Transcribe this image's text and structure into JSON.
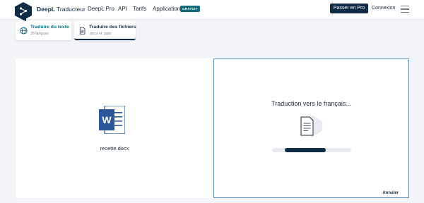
{
  "header": {
    "brand": "DeepL",
    "brand_sub": "Traducteur",
    "nav": [
      "DeepL Pro",
      "API",
      "Tarifs",
      "Applications"
    ],
    "badge": "GRATUIT",
    "pro_button": "Passer en Pro",
    "login": "Connexion"
  },
  "tabs": [
    {
      "title": "Traduire du texte",
      "subtitle": "26 langues"
    },
    {
      "title": "Traduire des fichiers",
      "subtitle": ".docx et .pptx"
    }
  ],
  "source": {
    "filename": "recette.docx"
  },
  "target": {
    "status": "Traduction vers le français...",
    "progress_start": 0.16,
    "progress_end": 0.68,
    "cancel": "Annuler"
  },
  "colors": {
    "brand_navy": "#0f2b46",
    "accent_teal": "#0b6a7e",
    "word_blue": "#2b579a",
    "panel_border": "#5d8fb5"
  }
}
